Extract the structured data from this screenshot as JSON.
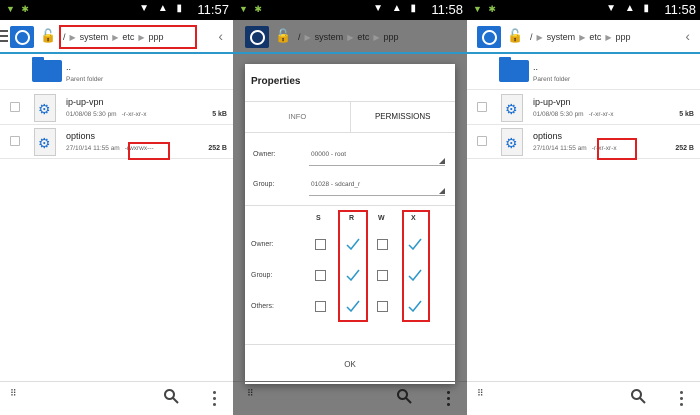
{
  "panels": [
    {
      "status_time": "11:57",
      "crumbs": [
        "/",
        "system",
        "etc",
        "ppp"
      ],
      "files": [
        {
          "name": "..",
          "sub": "Parent folder",
          "type": "folder"
        },
        {
          "name": "ip-up-vpn",
          "date": "01/08/08 5:30 pm",
          "perm": "-r-xr-xr-x",
          "size": "5 kB",
          "type": "file"
        },
        {
          "name": "options",
          "date": "27/10/14 11:55 am",
          "perm": "-rwxrwx---",
          "size": "252 B",
          "type": "file"
        }
      ]
    },
    {
      "status_time": "11:58",
      "crumbs": [
        "/",
        "system",
        "etc",
        "ppp"
      ]
    },
    {
      "status_time": "11:58",
      "crumbs": [
        "/",
        "system",
        "etc",
        "ppp"
      ],
      "files": [
        {
          "name": "..",
          "sub": "Parent folder",
          "type": "folder"
        },
        {
          "name": "ip-up-vpn",
          "date": "01/08/08 5:30 pm",
          "perm": "-r-xr-xr-x",
          "size": "5 kB",
          "type": "file"
        },
        {
          "name": "options",
          "date": "27/10/14 11:55 am",
          "perm": "-r-xr-xr-x",
          "size": "252 B",
          "type": "file"
        }
      ]
    }
  ],
  "dialog": {
    "title": "Properties",
    "tabs": [
      "INFO",
      "PERMISSIONS"
    ],
    "owner_label": "Owner:",
    "owner_value": "00000 - root",
    "group_label": "Group:",
    "group_value": "01028 - sdcard_r",
    "columns": [
      "S",
      "R",
      "W",
      "X"
    ],
    "rows": [
      {
        "label": "Owner:",
        "checks": [
          false,
          true,
          false,
          true
        ]
      },
      {
        "label": "Group:",
        "checks": [
          false,
          true,
          false,
          true
        ]
      },
      {
        "label": "Others:",
        "checks": [
          false,
          true,
          false,
          true
        ]
      }
    ],
    "ok_label": "OK"
  },
  "colors": {
    "accent": "#2c97c9",
    "brand": "#1e6fd0",
    "highlight": "#e02020",
    "check": "#2c97c9"
  }
}
